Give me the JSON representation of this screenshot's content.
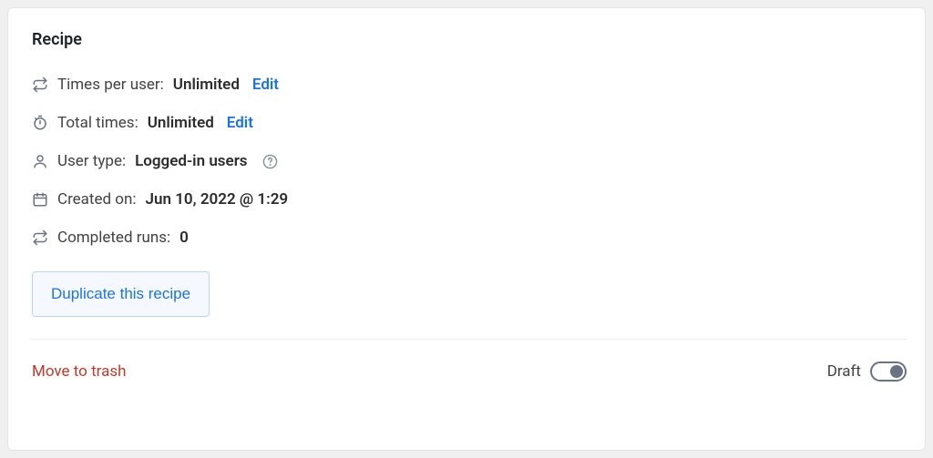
{
  "card": {
    "title": "Recipe"
  },
  "meta": {
    "times_per_user": {
      "label": "Times per user:",
      "value": "Unlimited",
      "edit": "Edit"
    },
    "total_times": {
      "label": "Total times:",
      "value": "Unlimited",
      "edit": "Edit"
    },
    "user_type": {
      "label": "User type:",
      "value": "Logged-in users"
    },
    "created_on": {
      "label": "Created on:",
      "value": "Jun 10, 2022 @ 1:29"
    },
    "completed_runs": {
      "label": "Completed runs:",
      "value": "0"
    }
  },
  "actions": {
    "duplicate": "Duplicate this recipe",
    "trash": "Move to trash"
  },
  "status": {
    "label": "Draft"
  }
}
